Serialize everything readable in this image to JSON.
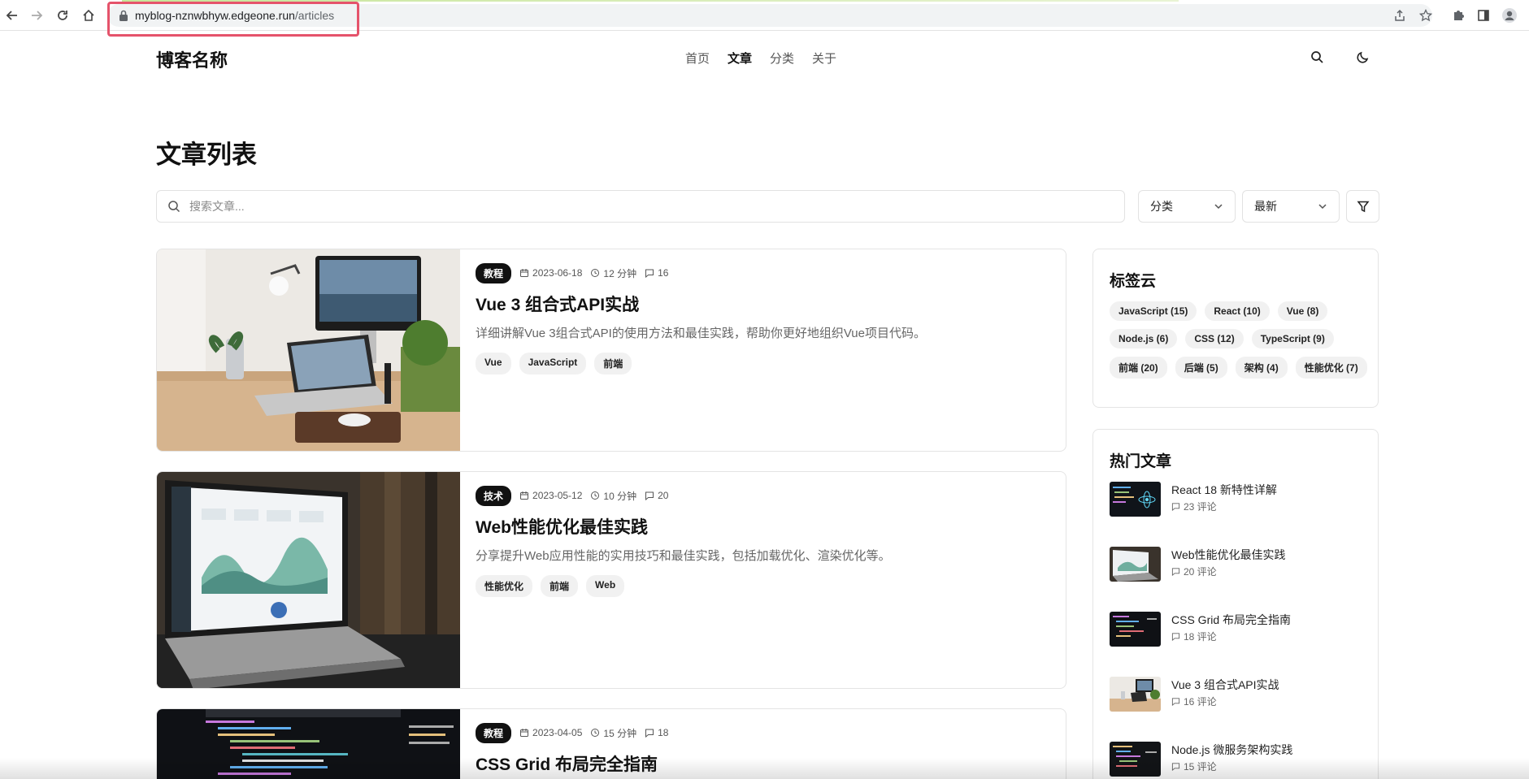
{
  "browser": {
    "url_host": "myblog-nznwbhyw.edgeone.run",
    "url_path": "/articles"
  },
  "site": {
    "title": "博客名称",
    "nav": [
      {
        "label": "首页",
        "active": false
      },
      {
        "label": "文章",
        "active": true
      },
      {
        "label": "分类",
        "active": false
      },
      {
        "label": "关于",
        "active": false
      }
    ]
  },
  "page": {
    "title": "文章列表",
    "search_placeholder": "搜索文章...",
    "category_select": "分类",
    "sort_select": "最新"
  },
  "articles": [
    {
      "badge": "教程",
      "date": "2023-06-18",
      "read_time": "12 分钟",
      "comments": "16",
      "title": "Vue 3 组合式API实战",
      "excerpt": "详细讲解Vue 3组合式API的使用方法和最佳实践，帮助你更好地组织Vue项目代码。",
      "tags": [
        "Vue",
        "JavaScript",
        "前端"
      ]
    },
    {
      "badge": "技术",
      "date": "2023-05-12",
      "read_time": "10 分钟",
      "comments": "20",
      "title": "Web性能优化最佳实践",
      "excerpt": "分享提升Web应用性能的实用技巧和最佳实践，包括加载优化、渲染优化等。",
      "tags": [
        "性能优化",
        "前端",
        "Web"
      ]
    },
    {
      "badge": "教程",
      "date": "2023-04-05",
      "read_time": "15 分钟",
      "comments": "18",
      "title": "CSS Grid 布局完全指南",
      "excerpt": "",
      "tags": []
    }
  ],
  "sidebar": {
    "tagcloud_title": "标签云",
    "tagcloud": [
      "JavaScript (15)",
      "React (10)",
      "Vue (8)",
      "Node.js (6)",
      "CSS (12)",
      "TypeScript (9)",
      "前端 (20)",
      "后端 (5)",
      "架构 (4)",
      "性能优化 (7)"
    ],
    "hot_title": "热门文章",
    "hot": [
      {
        "title": "React 18 新特性详解",
        "count": "23 评论"
      },
      {
        "title": "Web性能优化最佳实践",
        "count": "20 评论"
      },
      {
        "title": "CSS Grid 布局完全指南",
        "count": "18 评论"
      },
      {
        "title": "Vue 3 组合式API实战",
        "count": "16 评论"
      },
      {
        "title": "Node.js 微服务架构实践",
        "count": "15 评论"
      }
    ]
  },
  "colors": {
    "accent": "#111111",
    "url_highlight": "#e5536b"
  }
}
